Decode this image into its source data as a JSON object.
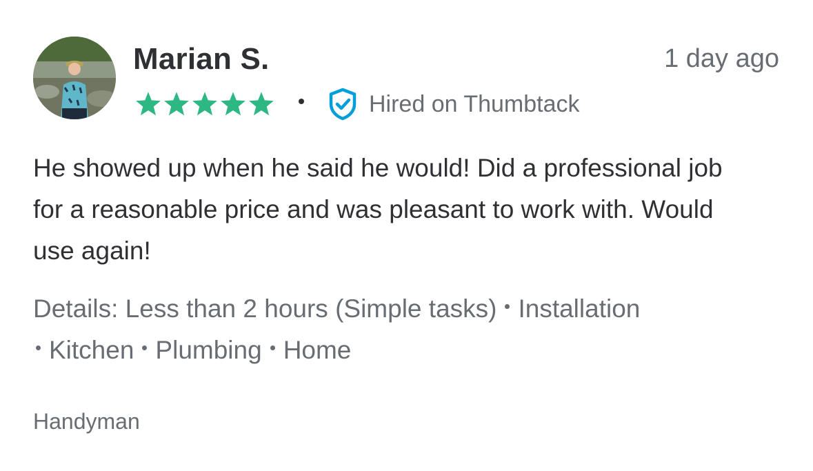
{
  "review": {
    "reviewer_name": "Marian S.",
    "timestamp": "1 day ago",
    "rating": 5,
    "rating_max": 5,
    "hired_label": "Hired on Thumbtack",
    "body": "He showed up when he said he would! Did a professional job for a reasonable price and was pleasant to work with. Would use again!",
    "details_prefix": "Details:",
    "details": [
      "Less than 2 hours (Simple tasks)",
      "Installation",
      "Kitchen",
      "Plumbing",
      "Home"
    ],
    "category": "Handyman"
  },
  "icons": {
    "star": "star-icon",
    "badge": "shield-check-icon",
    "avatar": "avatar"
  },
  "colors": {
    "star": "#2db783",
    "badge": "#009fd9",
    "primary_text": "#2f3033",
    "secondary_text": "#676d73"
  }
}
